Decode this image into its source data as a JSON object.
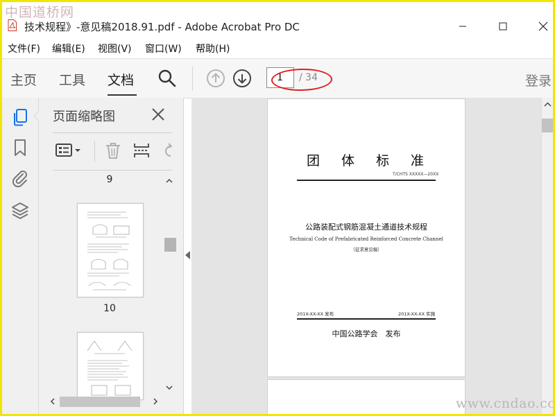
{
  "watermark": {
    "top": "中国道桥网",
    "bottom": "www.cndao.com"
  },
  "window": {
    "title": "技术规程》-意见稿2018.91.pdf - Adobe Acrobat Pro DC",
    "minimize": "—",
    "maximize": "☐",
    "close": "✕"
  },
  "menu": [
    "文件(F)",
    "编辑(E)",
    "视图(V)",
    "窗口(W)",
    "帮助(H)"
  ],
  "toolbar": {
    "tabs": [
      "主页",
      "工具",
      "文档"
    ],
    "active_tab": "文档",
    "page_current": "1",
    "page_total": "/ 34",
    "login": "登录"
  },
  "rail_icons": [
    "pages-icon",
    "bookmark-icon",
    "attachment-icon",
    "layers-icon"
  ],
  "thumbnails_panel": {
    "title": "页面缩略图",
    "page_labels": [
      "9",
      "10"
    ]
  },
  "document_page": {
    "heading": "团体标准",
    "code": "T/CHTS XXXXX—20XX",
    "title_cn": "公路装配式钢筋混凝土通道技术规程",
    "title_en": "Technical Code of Prefabricated Reinforced Concrete Channel",
    "subtitle": "（征求意见稿）",
    "issue_date": "201X-XX-XX 发布",
    "impl_date": "201X-XX-XX 实施",
    "publisher": "中国公路学会　发布"
  },
  "colors": {
    "annotation": "#e02020",
    "frame": "#f2e600",
    "rail_active": "#1473e6"
  }
}
